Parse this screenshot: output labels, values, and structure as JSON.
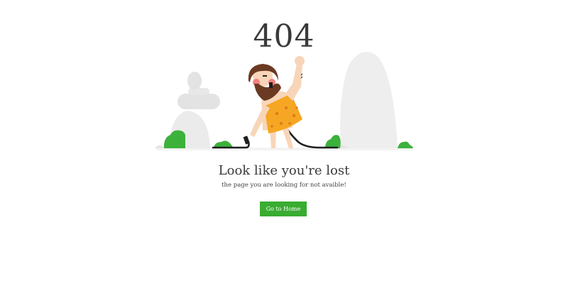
{
  "error": {
    "code": "404",
    "title": "Look like you're lost",
    "message": "the page you are looking for not avaible!"
  },
  "actions": {
    "home_label": "Go to Home"
  },
  "colors": {
    "accent": "#39ac31",
    "rock": "#eeeeee",
    "bush": "#3cb13c",
    "tunic": "#f5a623",
    "skin": "#f8d5b8",
    "beard": "#6b3a22",
    "cable": "#1f1f1f"
  },
  "icons": {
    "illustration": "caveman-unplugged-cable-icon"
  }
}
